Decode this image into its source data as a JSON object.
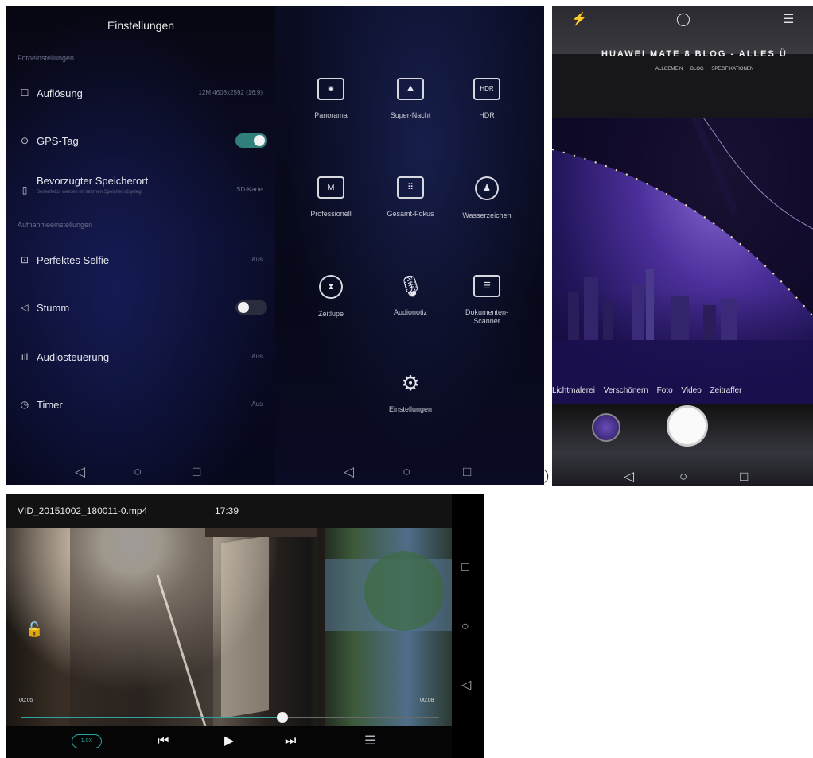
{
  "settings": {
    "title": "Einstellungen",
    "section_photo": "Fotoeinstellungen",
    "section_record": "Aufnahmeeinstellungen",
    "rows": [
      {
        "icon": "square-icon",
        "label": "Auflösung",
        "value": "12M 4608x2592 (16:9)"
      },
      {
        "icon": "location-pin-icon",
        "label": "GPS-Tag",
        "toggle": true
      },
      {
        "icon": "sd-card-icon",
        "label": "Bevorzugter Speicherort",
        "sub": "Serienfotos werden im internen Speicher abgelegt",
        "value": "SD-Karte"
      },
      {
        "icon": "selfie-icon",
        "label": "Perfektes Selfie",
        "value": "Aus"
      },
      {
        "icon": "speaker-mute-icon",
        "label": "Stumm",
        "toggle": false
      },
      {
        "icon": "audio-bars-icon",
        "label": "Audiosteuerung",
        "value": "Aus"
      },
      {
        "icon": "clock-icon",
        "label": "Timer",
        "value": "Aus"
      }
    ],
    "nav": {
      "back": "◁",
      "home": "○",
      "recent": "□"
    }
  },
  "modes": {
    "items": [
      {
        "label": "Panorama",
        "glyph": "◙"
      },
      {
        "label": "Super-Nacht",
        "glyph": "⛰"
      },
      {
        "label": "HDR",
        "glyph": "HDR"
      },
      {
        "label": "Professionell",
        "glyph": "M"
      },
      {
        "label": "Gesamt-Fokus",
        "glyph": "⠿"
      },
      {
        "label": "Wasserzeichen",
        "glyph": "♟"
      },
      {
        "label": "Zeitlupe",
        "glyph": "⧗"
      },
      {
        "label": "Audionotiz",
        "glyph": "🎙"
      },
      {
        "label": "Dokumenten-Scanner",
        "glyph": "☰"
      }
    ],
    "settings_label": "Einstellungen",
    "settings_glyph": "⚙",
    "nav": {
      "back": "◁",
      "home": "○",
      "recent": "□"
    }
  },
  "photo": {
    "blog_title": "HUAWEI MATE 8 BLOG - ALLES Ü",
    "blog_nav": "ALLGEMEIN BLOG SPEZIFIKATIONEN",
    "cam_tabs": "Lichtmalerei Verschönern Foto Video Zeitraffer",
    "paren": ")",
    "nav": {
      "back": "◁",
      "home": "○",
      "recent": "□"
    }
  },
  "video": {
    "filename": "VID_20151002_180011-0.mp4",
    "clock": "17:39",
    "current": "00:05",
    "duration": "00:08",
    "progress": 0.625,
    "speed": "1.0X",
    "controls": {
      "prev": "⏮",
      "play": "▶",
      "next": "⏭",
      "list": "☰"
    },
    "lock": "🔓",
    "sidenav": {
      "recent": "□",
      "home": "○",
      "back": "◁"
    }
  }
}
